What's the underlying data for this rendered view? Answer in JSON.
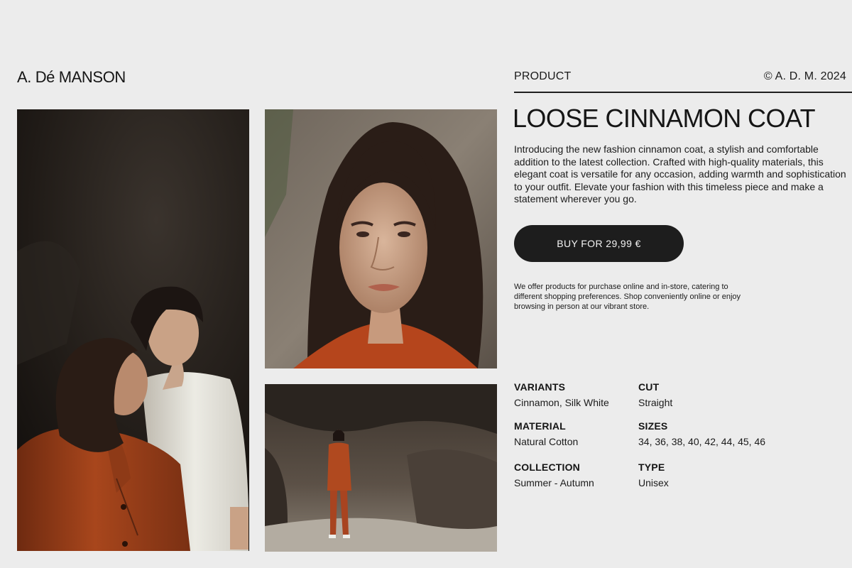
{
  "header": {
    "brand": "A. Dé MANSON",
    "section": "PRODUCT",
    "copyright": "© A. D. M. 2024"
  },
  "product": {
    "title": "LOOSE CINNAMON COAT",
    "description": "Introducing the new fashion cinnamon coat, a stylish and comfortable addition to the latest collection. Crafted with high-quality materials, this elegant coat is versatile for any occasion, adding warmth and sophistication to your outfit. Elevate your fashion with this timeless piece and make a statement wherever you go.",
    "buy_label": "BUY FOR 29,99 €",
    "note": "We offer products for purchase online and in-store, catering to different shopping preferences. Shop conveniently online or enjoy browsing in person at our vibrant store."
  },
  "specs": {
    "variants": {
      "label": "VARIANTS",
      "value": "Cinnamon, Silk White"
    },
    "cut": {
      "label": "CUT",
      "value": "Straight"
    },
    "material": {
      "label": "MATERIAL",
      "value": "Natural Cotton"
    },
    "sizes": {
      "label": "SIZES",
      "value": "34, 36, 38, 40, 42, 44, 45, 46"
    },
    "collection": {
      "label": "COLLECTION",
      "value": "Summer - Autumn"
    },
    "type": {
      "label": "TYPE",
      "value": "Unisex"
    }
  },
  "colors": {
    "background": "#ececec",
    "text": "#151515",
    "button": "#1d1d1d",
    "cinnamon": "#b0491f",
    "silk_white": "#ecebe4"
  }
}
